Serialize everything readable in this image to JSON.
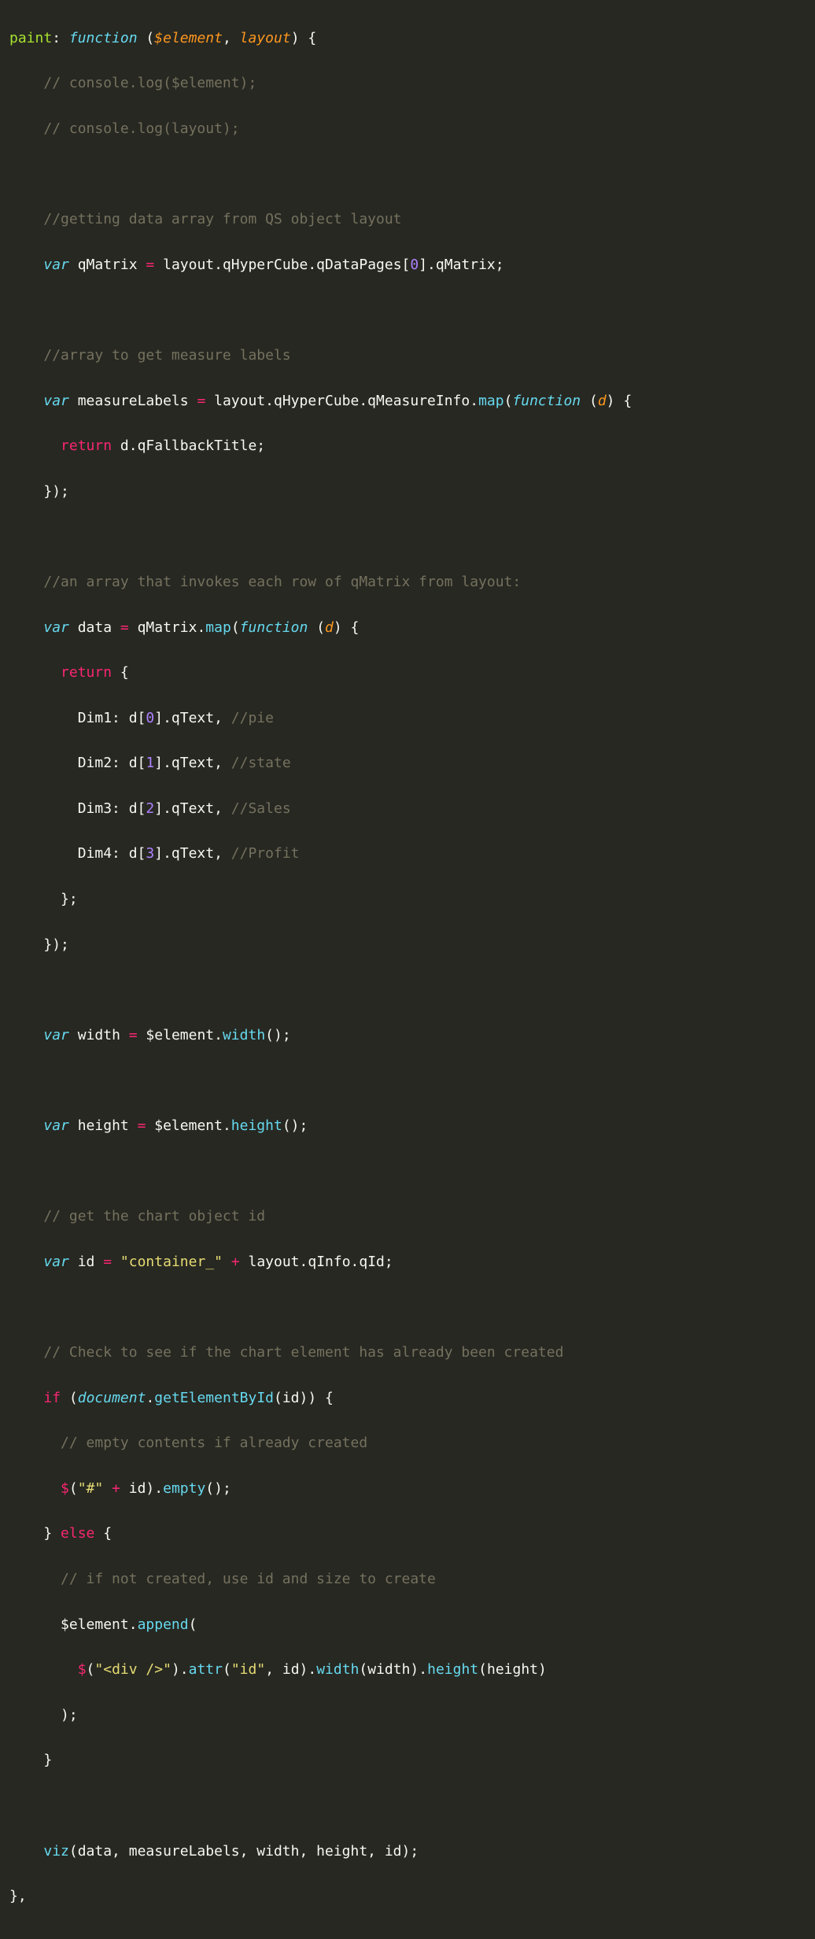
{
  "code": {
    "l1": {
      "green": "paint",
      "w1": ": ",
      "blue": "function ",
      "w2": "(",
      "or1": "$element",
      "w3": ", ",
      "or2": "layout",
      "w4": ") {"
    },
    "l2": {
      "c": "// console.log($element);"
    },
    "l3": {
      "c": "// console.log(layout);"
    },
    "l5": {
      "c": "//getting data array from QS object layout"
    },
    "l6": {
      "blue": "var ",
      "w1": "qMatrix ",
      "rd": "=",
      "w2": " layout.qHyperCube.qDataPages[",
      "pu": "0",
      "w3": "].qMatrix;"
    },
    "l8": {
      "c": "//array to get measure labels"
    },
    "l9": {
      "blue1": "var ",
      "w1": "measureLabels ",
      "rd": "=",
      "w2": " layout.qHyperCube.qMeasureInfo.",
      "bln": "map",
      "w3": "(",
      "blue2": "function ",
      "w4": "(",
      "or": "d",
      "w5": ") {"
    },
    "l10": {
      "rd": "return",
      "w": " d.qFallbackTitle;"
    },
    "l11": {
      "w": "});"
    },
    "l13": {
      "c": "//an array that invokes each row of qMatrix from layout:"
    },
    "l14": {
      "blue1": "var ",
      "w1": "data ",
      "rd": "=",
      "w2": " qMatrix.",
      "bln": "map",
      "w3": "(",
      "blue2": "function ",
      "w4": "(",
      "or": "d",
      "w5": ") {"
    },
    "l15": {
      "rd": "return",
      "w": " {"
    },
    "l16": {
      "w1": "Dim1: d[",
      "pu": "0",
      "w2": "].qText, ",
      "c": "//pie"
    },
    "l17": {
      "w1": "Dim2: d[",
      "pu": "1",
      "w2": "].qText, ",
      "c": "//state"
    },
    "l18": {
      "w1": "Dim3: d[",
      "pu": "2",
      "w2": "].qText, ",
      "c": "//Sales"
    },
    "l19": {
      "w1": "Dim4: d[",
      "pu": "3",
      "w2": "].qText, ",
      "c": "//Profit"
    },
    "l20": {
      "w": "};"
    },
    "l21": {
      "w": "});"
    },
    "l23": {
      "blue": "var ",
      "w1": "width ",
      "rd": "=",
      "w2": " $element.",
      "bln": "width",
      "w3": "();"
    },
    "l25": {
      "blue": "var ",
      "w1": "height ",
      "rd": "=",
      "w2": " $element.",
      "bln": "height",
      "w3": "();"
    },
    "l27": {
      "c": "// get the chart object id"
    },
    "l28": {
      "blue": "var ",
      "w1": "id ",
      "rd1": "=",
      "w2": " ",
      "st": "\"container_\"",
      "w3": " ",
      "rd2": "+",
      "w4": " layout.qInfo.qId;"
    },
    "l30": {
      "c": "// Check to see if the chart element has already been created"
    },
    "l31": {
      "rd": "if",
      "w1": " (",
      "blue": "document",
      "w2": ".",
      "bln": "getElementById",
      "w3": "(id)) {"
    },
    "l32": {
      "c": "// empty contents if already created"
    },
    "l33": {
      "rd1": "$",
      "w1": "(",
      "st": "\"#\"",
      "w2": " ",
      "rd2": "+",
      "w3": " id).",
      "bln": "empty",
      "w4": "();"
    },
    "l34": {
      "w1": "} ",
      "rd": "else",
      "w2": " {"
    },
    "l35": {
      "c": "// if not created, use id and size to create"
    },
    "l36": {
      "w": "$element.",
      "bln": "append",
      "w2": "("
    },
    "l37": {
      "rd": "$",
      "w1": "(",
      "st1": "\"<div />\"",
      "w2": ").",
      "bln1": "attr",
      "w3": "(",
      "st2": "\"id\"",
      "w4": ", id).",
      "bln2": "width",
      "w5": "(width).",
      "bln3": "height",
      "w6": "(height)"
    },
    "l38": {
      "w": ");"
    },
    "l39": {
      "w": "}"
    },
    "l41": {
      "bln": "viz",
      "w": "(data, measureLabels, width, height, id);"
    },
    "l42": {
      "w": "},"
    }
  }
}
